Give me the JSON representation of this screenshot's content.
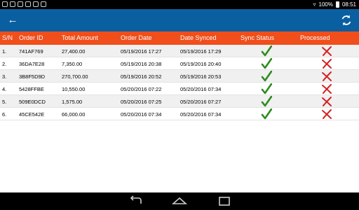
{
  "status_bar": {
    "battery": "100%",
    "time": "08:51"
  },
  "app_bar": {
    "back_icon": "arrow-left-icon",
    "refresh_icon": "refresh-icon",
    "color": "#0a5fa0"
  },
  "table": {
    "header_color": "#f04e1b",
    "headers": {
      "sn": "S/N",
      "order_id": "Order ID",
      "total_amount": "Total Amount",
      "order_date": "Order Date",
      "date_synced": "Date Synced",
      "sync_status": "Sync Status",
      "processed": "Processed"
    },
    "rows": [
      {
        "sn": "1.",
        "order_id": "741AF769",
        "total_amount": "27,400.00",
        "order_date": "05/19/2016 17:27",
        "date_synced": "05/19/2016 17:29",
        "sync_status": "check-icon",
        "processed": "cross-icon"
      },
      {
        "sn": "2.",
        "order_id": "36DA7E28",
        "total_amount": "7,350.00",
        "order_date": "05/19/2016 20:38",
        "date_synced": "05/19/2016 20:40",
        "sync_status": "check-icon",
        "processed": "cross-icon"
      },
      {
        "sn": "3.",
        "order_id": "3B8F5D9D",
        "total_amount": "270,700.00",
        "order_date": "05/19/2016 20:52",
        "date_synced": "05/19/2016 20:53",
        "sync_status": "check-icon",
        "processed": "cross-icon"
      },
      {
        "sn": "4.",
        "order_id": "5428FFBE",
        "total_amount": "10,550.00",
        "order_date": "05/20/2016 07:22",
        "date_synced": "05/20/2016 07:34",
        "sync_status": "check-icon",
        "processed": "cross-icon"
      },
      {
        "sn": "5.",
        "order_id": "509E0DCD",
        "total_amount": "1,575.00",
        "order_date": "05/20/2016 07:25",
        "date_synced": "05/20/2016 07:27",
        "sync_status": "check-icon",
        "processed": "cross-icon"
      },
      {
        "sn": "6.",
        "order_id": "45CE542E",
        "total_amount": "66,000.00",
        "order_date": "05/20/2016 07:34",
        "date_synced": "05/20/2016 07:34",
        "sync_status": "check-icon",
        "processed": "cross-icon"
      }
    ]
  },
  "nav_bar": {
    "back_icon": "nav-back-icon",
    "home_icon": "nav-home-icon",
    "recents_icon": "nav-recents-icon"
  }
}
